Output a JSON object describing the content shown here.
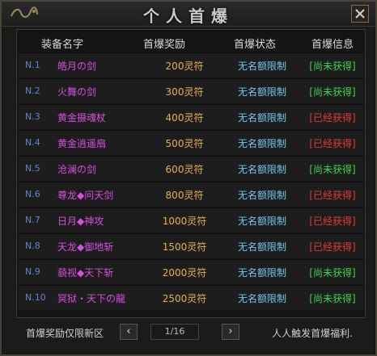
{
  "title": "个人首爆",
  "headers": {
    "name": "装备名字",
    "reward": "首爆奖励",
    "status": "首爆状态",
    "info": "首爆信息"
  },
  "rows": [
    {
      "num": "N.1",
      "name": "皓月の剑",
      "reward": "200灵符",
      "limit": "无名额限制",
      "info": "[尚未获得]",
      "info_color": "#39d44a"
    },
    {
      "num": "N.2",
      "name": "火舞の剑",
      "reward": "300灵符",
      "limit": "无名额限制",
      "info": "[尚未获得]",
      "info_color": "#39d44a"
    },
    {
      "num": "N.3",
      "name": "黄金摄魂杖",
      "reward": "400灵符",
      "limit": "无名额限制",
      "info": "[已经获得]",
      "info_color": "#e23a3a"
    },
    {
      "num": "N.4",
      "name": "黄金逍遥扇",
      "reward": "500灵符",
      "limit": "无名额限制",
      "info": "[已经获得]",
      "info_color": "#e23a3a"
    },
    {
      "num": "N.5",
      "name": "沧澜の剑",
      "reward": "600灵符",
      "limit": "无名额限制",
      "info": "[尚未获得]",
      "info_color": "#39d44a"
    },
    {
      "num": "N.6",
      "name": "尊龙◆问天剑",
      "reward": "800灵符",
      "limit": "无名额限制",
      "info": "[已经获得]",
      "info_color": "#e23a3a"
    },
    {
      "num": "N.7",
      "name": "日月◆神攻",
      "reward": "1000灵符",
      "limit": "无名额限制",
      "info": "[已经获得]",
      "info_color": "#e23a3a"
    },
    {
      "num": "N.8",
      "name": "天龙◆御地斩",
      "reward": "1500灵符",
      "limit": "无名额限制",
      "info": "[已经获得]",
      "info_color": "#e23a3a"
    },
    {
      "num": "N.9",
      "name": "藐视◆天下斩",
      "reward": "2000灵符",
      "limit": "无名额限制",
      "info": "[尚未获得]",
      "info_color": "#39d44a"
    },
    {
      "num": "N.10",
      "name": "冥狱・天下の龍",
      "reward": "2500灵符",
      "limit": "无名额限制",
      "info": "[尚未获得]",
      "info_color": "#39d44a"
    }
  ],
  "footer": {
    "left_text": "首爆奖励仅限新区",
    "prev": "‹",
    "next": "›",
    "page": "1/16",
    "right_text": "人人触发首爆福利."
  },
  "icons": {
    "logo": "dragon-logo-icon",
    "close": "close-icon"
  }
}
